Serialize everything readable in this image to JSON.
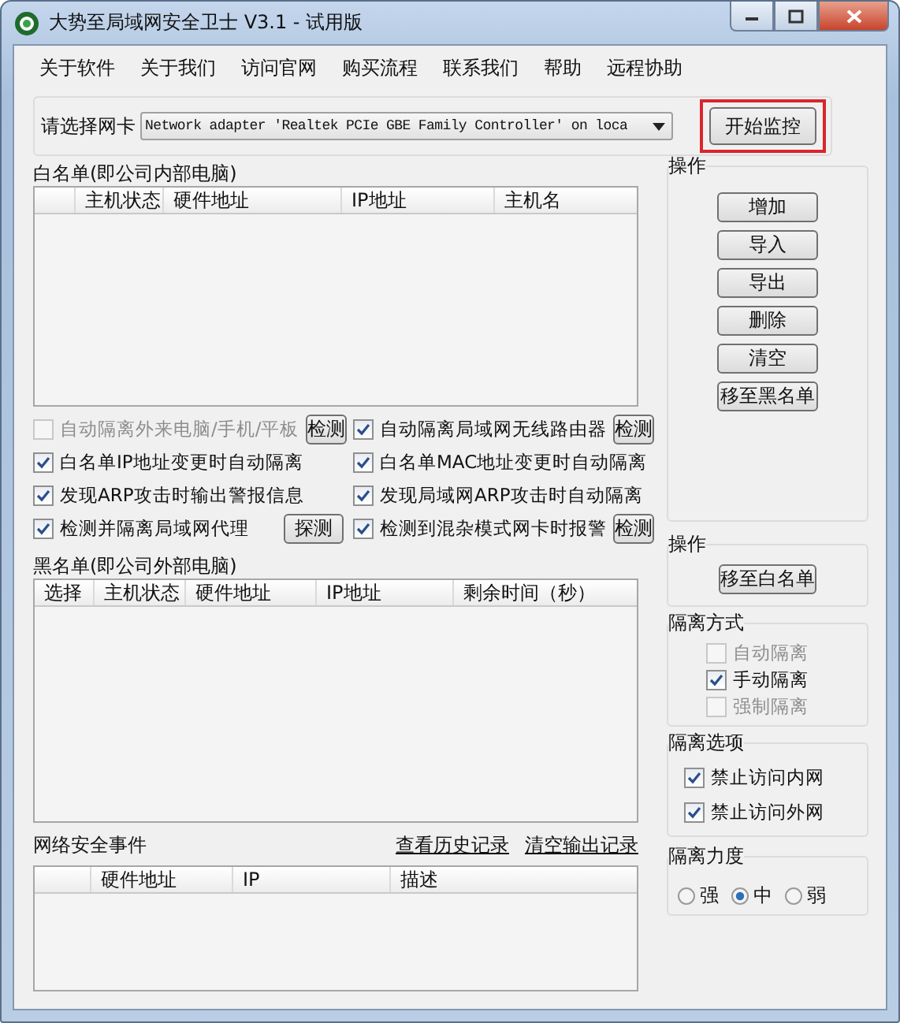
{
  "window": {
    "title": "大势至局域网安全卫士 V3.1 - 试用版"
  },
  "menu": [
    "关于软件",
    "关于我们",
    "访问官网",
    "购买流程",
    "联系我们",
    "帮助",
    "远程协助"
  ],
  "adapter": {
    "label": "请选择网卡",
    "value": "Network adapter 'Realtek PCIe GBE Family Controller' on loca",
    "start_button": {
      "label": "开始监控",
      "highlighted": true
    }
  },
  "whitelist": {
    "title": "白名单(即公司内部电脑)",
    "columns": [
      "主机状态",
      "硬件地址",
      "IP地址",
      "主机名"
    ]
  },
  "options": [
    {
      "label": "自动隔离外来电脑/手机/平板",
      "checked": false,
      "disabled": true,
      "button": "检测"
    },
    {
      "label": "自动隔离局域网无线路由器",
      "checked": true,
      "disabled": false,
      "button": "检测"
    },
    {
      "label": "白名单IP地址变更时自动隔离",
      "checked": true,
      "disabled": false
    },
    {
      "label": "白名单MAC地址变更时自动隔离",
      "checked": true,
      "disabled": false
    },
    {
      "label": "发现ARP攻击时输出警报信息",
      "checked": true,
      "disabled": false
    },
    {
      "label": "发现局域网ARP攻击时自动隔离",
      "checked": true,
      "disabled": false
    },
    {
      "label": "检测并隔离局域网代理",
      "checked": true,
      "disabled": false,
      "button": "探测"
    },
    {
      "label": "检测到混杂模式网卡时报警",
      "checked": true,
      "disabled": false,
      "button": "检测"
    }
  ],
  "blacklist": {
    "title": "黑名单(即公司外部电脑)",
    "columns": [
      "选择",
      "主机状态",
      "硬件地址",
      "IP地址",
      "剩余时间（秒）"
    ]
  },
  "events": {
    "title": "网络安全事件",
    "links": [
      "查看历史记录",
      "清空输出记录"
    ],
    "columns": [
      "硬件地址",
      "IP",
      "描述"
    ]
  },
  "whitelist_actions": {
    "title": "操作",
    "buttons": [
      "增加",
      "导入",
      "导出",
      "删除",
      "清空",
      "移至黑名单"
    ]
  },
  "blacklist_actions": {
    "title": "操作",
    "buttons": [
      "移至白名单"
    ]
  },
  "isolation_mode": {
    "title": "隔离方式",
    "items": [
      {
        "label": "自动隔离",
        "checked": false,
        "disabled": true
      },
      {
        "label": "手动隔离",
        "checked": true,
        "disabled": false
      },
      {
        "label": "强制隔离",
        "checked": false,
        "disabled": true
      }
    ]
  },
  "isolation_options": {
    "title": "隔离选项",
    "items": [
      {
        "label": "禁止访问内网",
        "checked": true,
        "disabled": false
      },
      {
        "label": "禁止访问外网",
        "checked": true,
        "disabled": false
      }
    ]
  },
  "isolation_strength": {
    "title": "隔离力度",
    "items": [
      {
        "label": "强",
        "selected": false
      },
      {
        "label": "中",
        "selected": true
      },
      {
        "label": "弱",
        "selected": false
      }
    ]
  }
}
